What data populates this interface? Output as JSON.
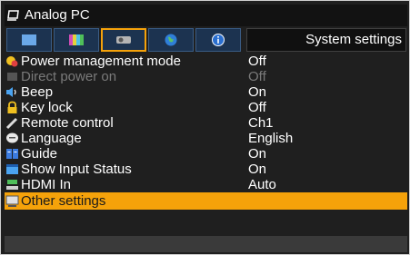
{
  "header": {
    "title": "Analog PC"
  },
  "tabs": [
    {
      "icon": "screen-tab-icon"
    },
    {
      "icon": "color-bars-tab-icon"
    },
    {
      "icon": "projector-tab-icon"
    },
    {
      "icon": "network-globe-tab-icon"
    },
    {
      "icon": "info-tab-icon"
    }
  ],
  "tab_title": "System settings",
  "menu": [
    {
      "label": "Power management mode",
      "value": "Off",
      "icon": "power-management-icon"
    },
    {
      "label": "Direct power on",
      "value": "Off",
      "icon": "direct-power-icon",
      "disabled": true
    },
    {
      "label": "Beep",
      "value": "On",
      "icon": "speaker-icon"
    },
    {
      "label": "Key lock",
      "value": "Off",
      "icon": "lock-icon"
    },
    {
      "label": "Remote control",
      "value": "Ch1",
      "icon": "remote-control-icon"
    },
    {
      "label": "Language",
      "value": "English",
      "icon": "speech-bubble-icon"
    },
    {
      "label": "Guide",
      "value": "On",
      "icon": "book-icon"
    },
    {
      "label": "Show Input Status",
      "value": "On",
      "icon": "window-icon"
    },
    {
      "label": "HDMI In",
      "value": "Auto",
      "icon": "hdmi-icon"
    },
    {
      "label": "Other settings",
      "value": "",
      "icon": "settings-icon",
      "selected": true
    }
  ],
  "colors": {
    "accent": "#f5a20a",
    "background": "#1f1f1f",
    "tab_bg": "#1c3350"
  }
}
